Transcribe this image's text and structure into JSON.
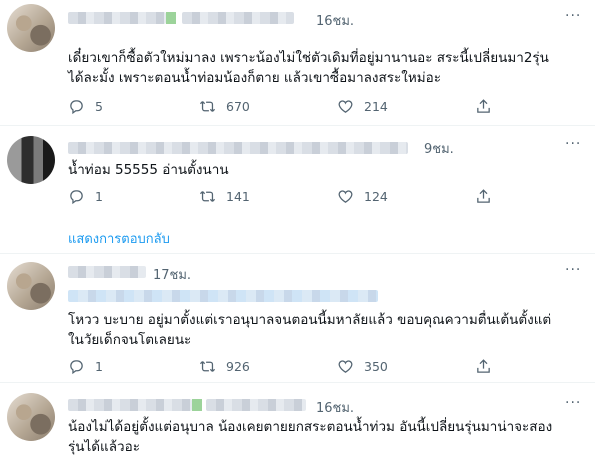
{
  "tweets": [
    {
      "time": "16ชม.",
      "lines": [
        "เดี๋ยวเขาก็ซื้อตัวใหม่มาลง เพราะน้องไม่ใช่ตัวเดิมที่อยู่มานานอะ สระนี้เปลี่ยนมา2รุ่น",
        "ได้ละมั้ง เพราะตอนน้ำท่อมน้องก็ตาย แล้วเขาซื้อมาลงสระใหม่อะ"
      ],
      "replies": "5",
      "retweets": "670",
      "likes": "214"
    },
    {
      "time": "9ชม.",
      "lines": [
        "น้ำท่อม 55555 อ่านตั้งนาน"
      ],
      "replies": "1",
      "retweets": "141",
      "likes": "124"
    },
    {
      "time": "17ชม.",
      "lines": [
        "โหวว บะบาย อยู่มาตั้งแต่เราอนุบาลจนตอนนี้มหาลัยแล้ว ขอบคุณความตื่นเต้นตั้งแต่",
        "ในวัยเด็กจนโตเลยนะ"
      ],
      "replies": "1",
      "retweets": "926",
      "likes": "350"
    },
    {
      "time": "16ชม.",
      "lines": [
        "น้องไม่ได้อยู่ตั้งแต่อนุบาล น้องเคยตายยกสระตอนน้ำท่วม อันนี้เปลี่ยนรุ่นมาน่าจะสอง",
        "รุ่นได้แล้วอะ"
      ]
    }
  ],
  "show_replies": "แสดงการตอบกลับ",
  "more_label": "···",
  "colors": {
    "accent": "#1d9bf0",
    "muted": "#536471",
    "text": "#0f1419"
  },
  "icons": [
    "reply-icon",
    "retweet-icon",
    "like-icon",
    "share-icon",
    "more-icon"
  ]
}
